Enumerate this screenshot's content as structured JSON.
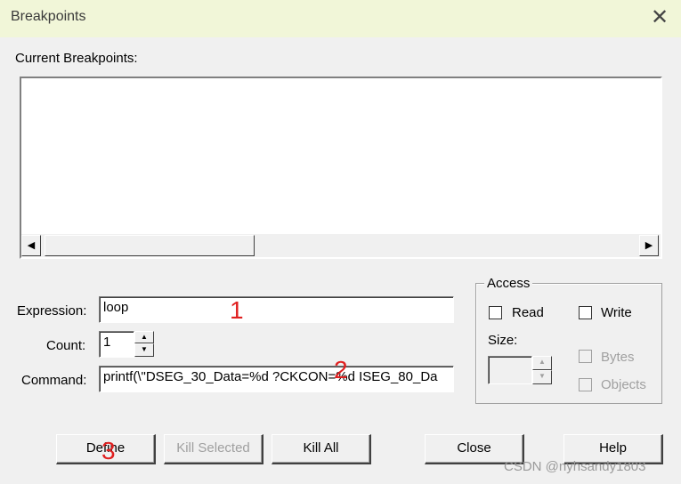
{
  "window": {
    "title": "Breakpoints"
  },
  "current_breakpoints": {
    "label": "Current Breakpoints:"
  },
  "form": {
    "expression_label": "Expression:",
    "expression_value": "loop",
    "count_label": "Count:",
    "count_value": "1",
    "command_label": "Command:",
    "command_value": "printf(\\\"DSEG_30_Data=%d ?CKCON=%d ISEG_80_Da"
  },
  "access": {
    "title": "Access",
    "read_label": "Read",
    "write_label": "Write",
    "size_label": "Size:",
    "bytes_label": "Bytes",
    "objects_label": "Objects"
  },
  "buttons": {
    "define": "Define",
    "kill_selected": "Kill Selected",
    "kill_all": "Kill All",
    "close": "Close",
    "help": "Help"
  },
  "annotations": [
    "1",
    "2",
    "3"
  ],
  "watermark": "CSDN @nyhsandy1803",
  "colors": {
    "titlebar": "#f1f6d8",
    "annotation": "#e02020"
  }
}
